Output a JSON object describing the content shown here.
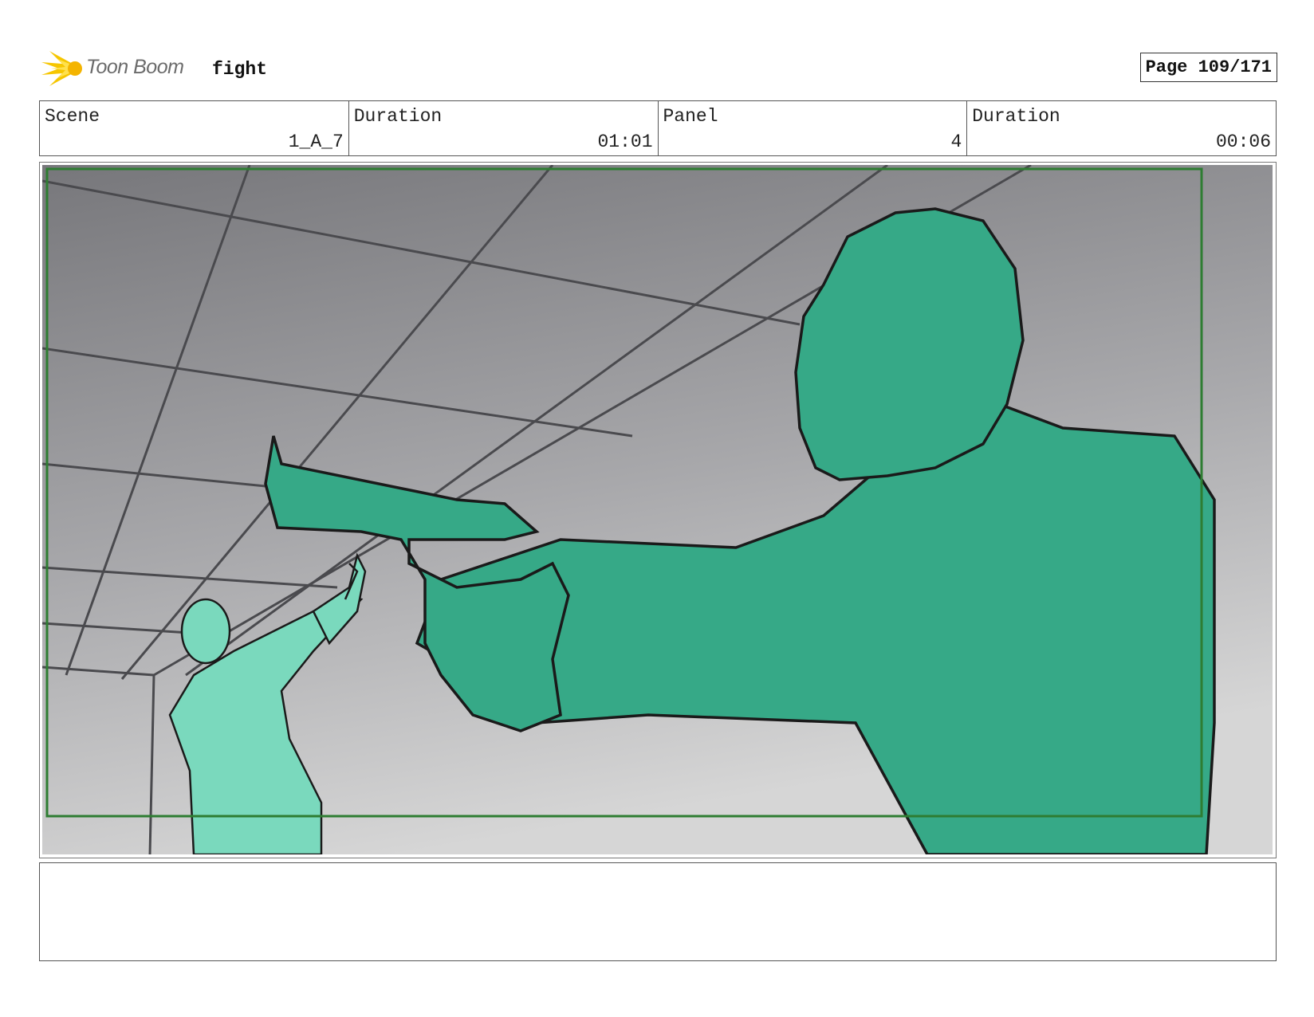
{
  "header": {
    "logo_text": "Toon Boom",
    "project_name": "fight",
    "page_label": "Page 109/171"
  },
  "info": [
    {
      "label": "Scene",
      "value": "1_A_7"
    },
    {
      "label": "Duration",
      "value": "01:01"
    },
    {
      "label": "Panel",
      "value": "4"
    },
    {
      "label": "Duration",
      "value": "00:06"
    }
  ],
  "panel": {
    "figure_color": "#36a987",
    "figure_light_color": "#7ad9bd",
    "frame_color": "#2e7d32"
  },
  "notes": {
    "text": ""
  }
}
